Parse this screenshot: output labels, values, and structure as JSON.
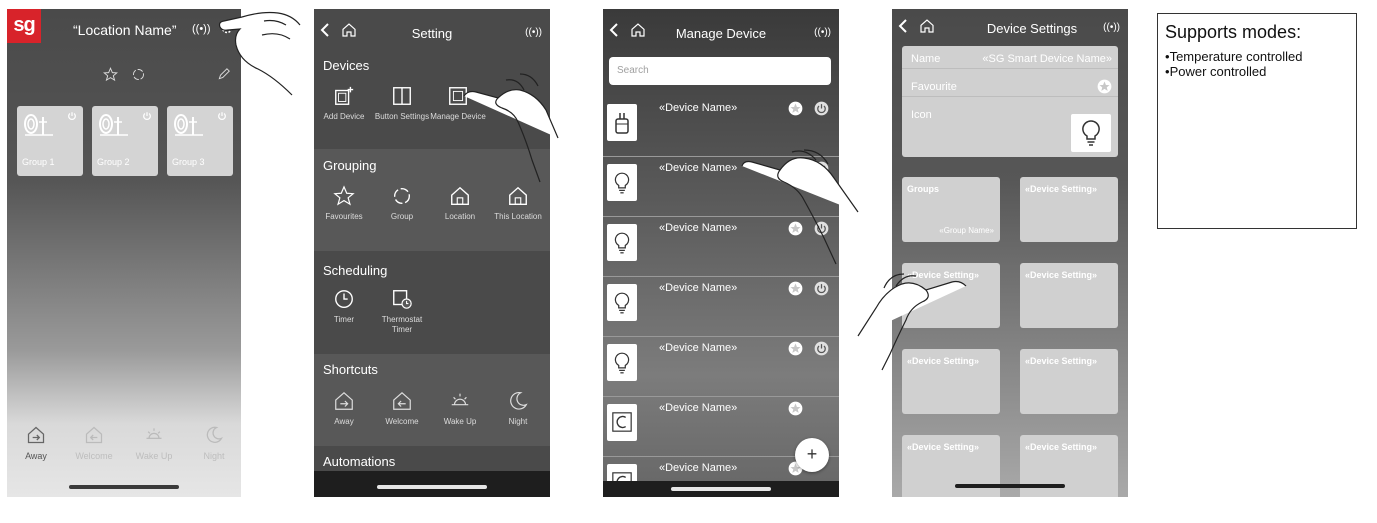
{
  "home": {
    "logo": "sg",
    "location_title": "“Location Name”",
    "signal": "((•))",
    "groups": [
      {
        "label": "Group 1"
      },
      {
        "label": "Group 2"
      },
      {
        "label": "Group 3"
      }
    ],
    "shortcuts": [
      {
        "label": "Away",
        "icon": "away-icon"
      },
      {
        "label": "Welcome",
        "icon": "welcome-icon"
      },
      {
        "label": "Wake Up",
        "icon": "wake-up-icon"
      },
      {
        "label": "Night",
        "icon": "night-icon"
      }
    ]
  },
  "setting": {
    "title": "Setting",
    "signal": "((•))",
    "sections": {
      "devices": {
        "title": "Devices",
        "items": [
          {
            "label": "Add Device"
          },
          {
            "label": "Button Settings"
          },
          {
            "label": "Manage Device"
          }
        ]
      },
      "grouping": {
        "title": "Grouping",
        "items": [
          {
            "label": "Favourites"
          },
          {
            "label": "Group"
          },
          {
            "label": "Location"
          },
          {
            "label": "This Location"
          }
        ]
      },
      "scheduling": {
        "title": "Scheduling",
        "items": [
          {
            "label": "Timer"
          },
          {
            "label": "Thermostat Timer"
          }
        ]
      },
      "shortcuts": {
        "title": "Shortcuts",
        "items": [
          {
            "label": "Away"
          },
          {
            "label": "Welcome"
          },
          {
            "label": "Wake Up"
          },
          {
            "label": "Night"
          }
        ]
      },
      "automations": {
        "title": "Automations"
      }
    }
  },
  "manage_device": {
    "title": "Manage Device",
    "signal": "((•))",
    "search_placeholder": "Search",
    "devices": [
      {
        "name": "«Device Name»",
        "icon": "plug-icon"
      },
      {
        "name": "«Device Name»",
        "icon": "bulb-icon"
      },
      {
        "name": "«Device Name»",
        "icon": "bulb-icon"
      },
      {
        "name": "«Device Name»",
        "icon": "bulb-icon"
      },
      {
        "name": "«Device Name»",
        "icon": "bulb-icon"
      },
      {
        "name": "«Device Name»",
        "icon": "thermostat-icon"
      },
      {
        "name": "«Device Name»",
        "icon": "thermostat-icon"
      }
    ],
    "add_button": "+"
  },
  "device_settings": {
    "title": "Device Settings",
    "signal": "((•))",
    "name_label": "Name",
    "name_value": "«SG Smart Device Name»",
    "favourite_label": "Favourite",
    "icon_label": "Icon",
    "tiles": [
      {
        "title": "Groups",
        "sub": "«Group Name»"
      },
      {
        "title": "«Device Setting»"
      },
      {
        "title": "«Device Setting»"
      },
      {
        "title": "«Device Setting»"
      },
      {
        "title": "«Device Setting»"
      },
      {
        "title": "«Device Setting»"
      },
      {
        "title": "«Device Setting»"
      },
      {
        "title": "«Device Setting»"
      }
    ]
  },
  "info": {
    "title": "Supports modes:",
    "modes": [
      "Temperature controlled",
      "Power controlled"
    ]
  },
  "colors": {
    "brand_red": "#d8232a",
    "dark_bg": "#4a4a4a",
    "tile_grey": "#d0d0d0"
  }
}
